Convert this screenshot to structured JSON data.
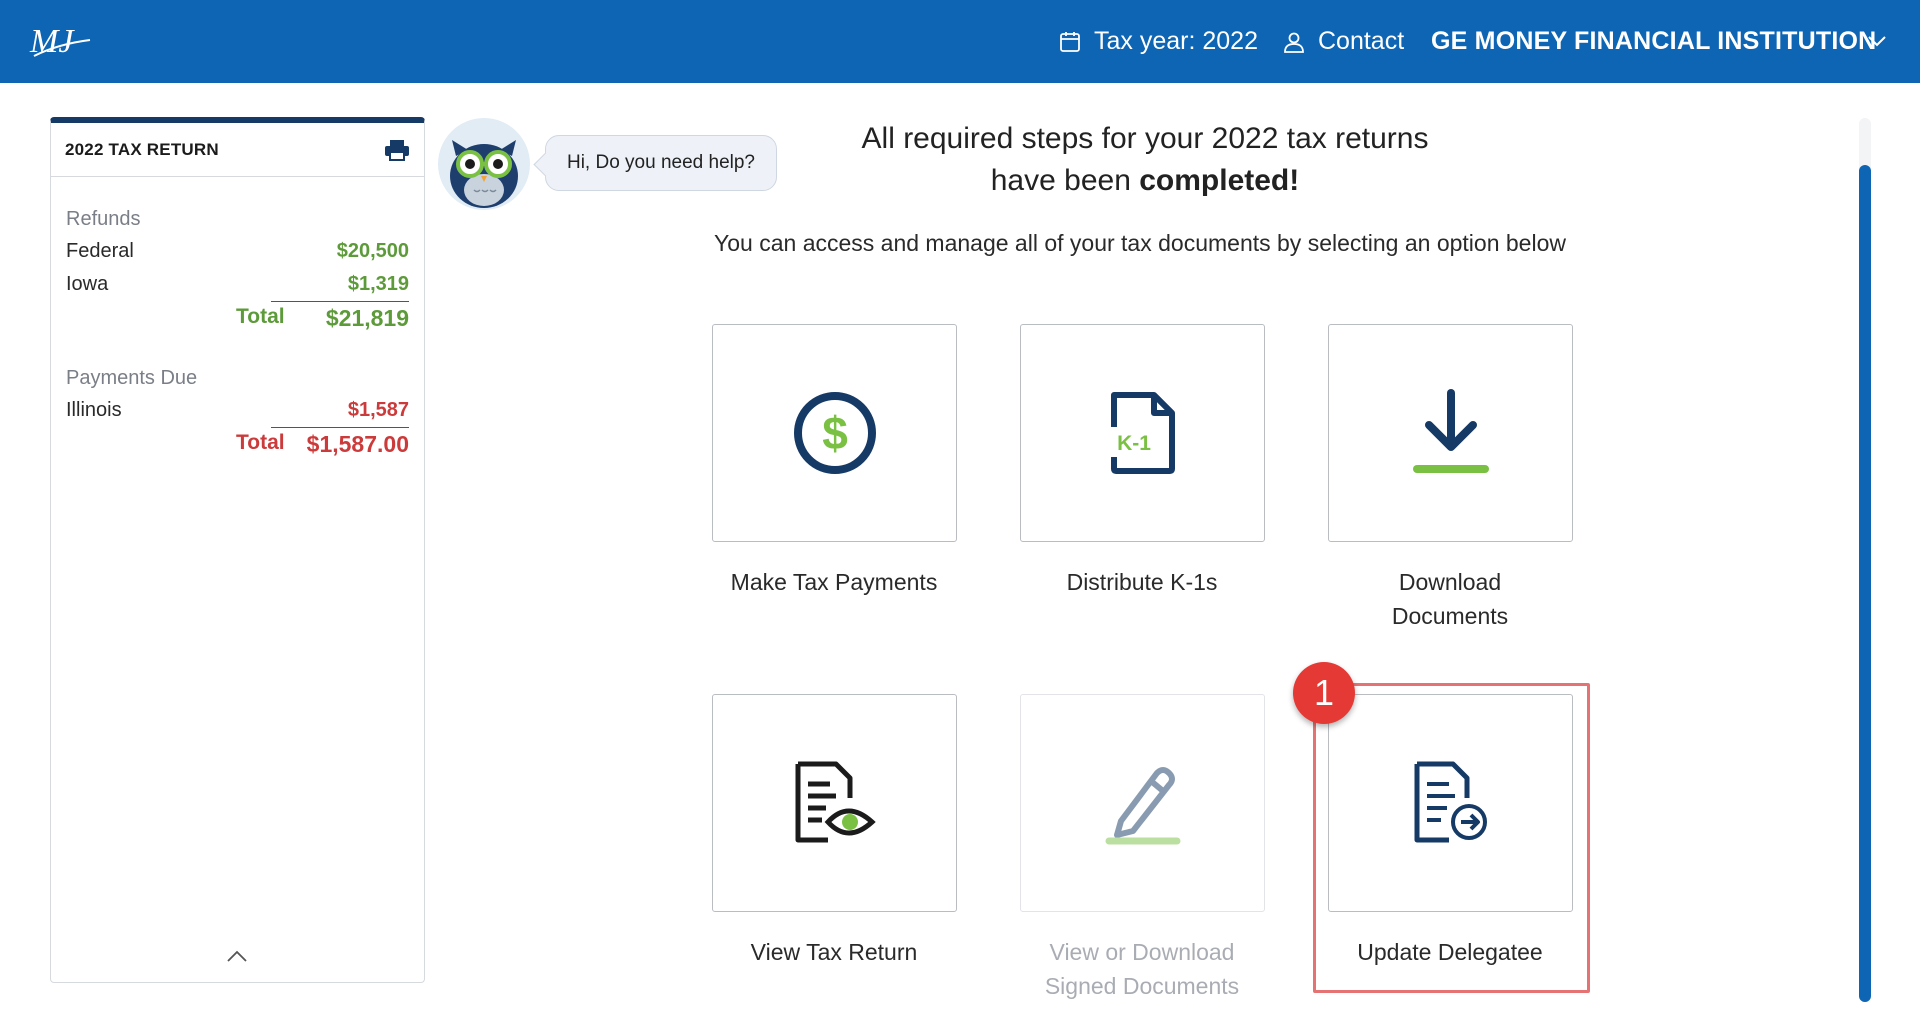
{
  "header": {
    "logo_text": "MJ",
    "tax_year_label": "Tax year: 2022",
    "contact_label": "Contact",
    "institution_name": "GE MONEY FINANCIAL INSTITUTION"
  },
  "sidebar": {
    "title": "2022 TAX RETURN",
    "refunds": {
      "label": "Refunds",
      "items": [
        {
          "name": "Federal",
          "amount": "$20,500"
        },
        {
          "name": "Iowa",
          "amount": "$1,319"
        }
      ],
      "total_label": "Total",
      "total_amount": "$21,819"
    },
    "payments": {
      "label": "Payments Due",
      "items": [
        {
          "name": "Illinois",
          "amount": "$1,587"
        }
      ],
      "total_label": "Total",
      "total_amount": "$1,587.00"
    }
  },
  "helper": {
    "bubble_text": "Hi, Do you need help?"
  },
  "main": {
    "headline_line1": "All required steps for your 2022 tax returns",
    "headline_line2_prefix": "have been ",
    "headline_line2_bold": "completed!",
    "subline": "You can access and manage all of your tax documents by selecting an option below",
    "tiles": [
      {
        "label": "Make Tax Payments",
        "icon": "dollar-icon"
      },
      {
        "label": "Distribute K-1s",
        "icon": "k1-document-icon",
        "icon_text": "K-1"
      },
      {
        "label_line1": "Download",
        "label_line2": "Documents",
        "icon": "download-icon"
      },
      {
        "label": "View Tax Return",
        "icon": "document-eye-icon"
      },
      {
        "label_line1": "View or Download",
        "label_line2": "Signed Documents",
        "icon": "pen-icon",
        "disabled": true
      },
      {
        "label": "Update Delegatee",
        "icon": "document-arrow-icon"
      }
    ]
  },
  "annotation": {
    "badge_number": "1",
    "badge_color": "#e53935",
    "highlight_color": "#e57373"
  },
  "colors": {
    "brand_blue": "#0d65b3",
    "navy": "#163a66",
    "refund_green": "#5d9b3a",
    "due_red": "#cc3b3b",
    "icon_green": "#7ac143"
  }
}
